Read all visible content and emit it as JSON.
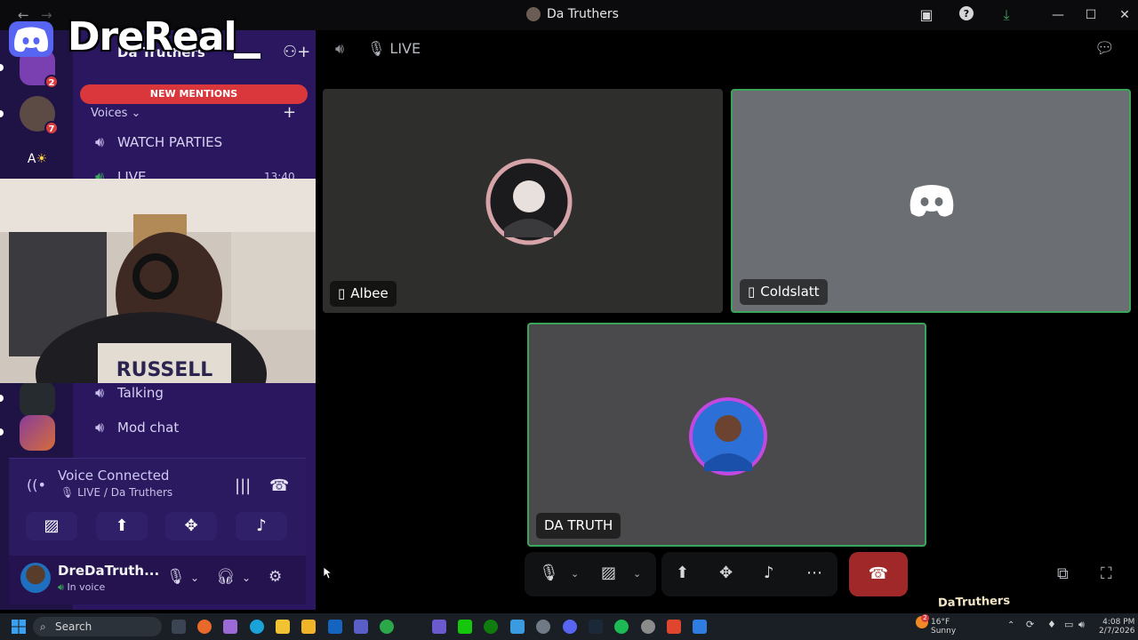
{
  "window": {
    "title": "Da Truthers"
  },
  "overlay": {
    "streamer_name": "DreReal",
    "watermark": "DaTruthers"
  },
  "servers": [
    {
      "badge": "2",
      "color": "#7a3fb0"
    },
    {
      "badge": "7",
      "color": "#5c4a45"
    },
    {
      "label": "A",
      "color": "#2a1760"
    },
    {
      "label": "",
      "color": "#262b2f"
    },
    {
      "label": "",
      "color": "#8a3d9a"
    }
  ],
  "channels": {
    "guild_name": "Da Truthers",
    "new_mentions": "NEW MENTIONS",
    "category": "Voices",
    "items": [
      {
        "name": "WATCH PARTIES"
      },
      {
        "name": "LIVE",
        "time": "13:40"
      },
      {
        "name": "Talking"
      },
      {
        "name": "Mod chat"
      }
    ]
  },
  "voice": {
    "status": "Voice Connected",
    "channel": "LIVE / Da Truthers"
  },
  "user": {
    "name": "DreDaTruth...",
    "status": "In voice"
  },
  "call": {
    "channel_label": "LIVE",
    "participants": [
      {
        "name": "Albee",
        "device": "mobile",
        "speaking": false
      },
      {
        "name": "Coldslatt",
        "device": "mobile",
        "speaking": true
      },
      {
        "name": "DA TRUTH",
        "device": "",
        "speaking": true
      }
    ]
  },
  "taskbar": {
    "search_placeholder": "Search",
    "weather_temp": "16°F",
    "weather_text": "Sunny",
    "weather_badge": "2",
    "time": "4:08 PM",
    "date": "2/7/2026"
  },
  "colors": {
    "brand": "#5865f2",
    "danger": "#da373c",
    "speaking": "#3ba55c",
    "rail_bg": "#1f1345",
    "channel_bg": "#2a1760"
  }
}
